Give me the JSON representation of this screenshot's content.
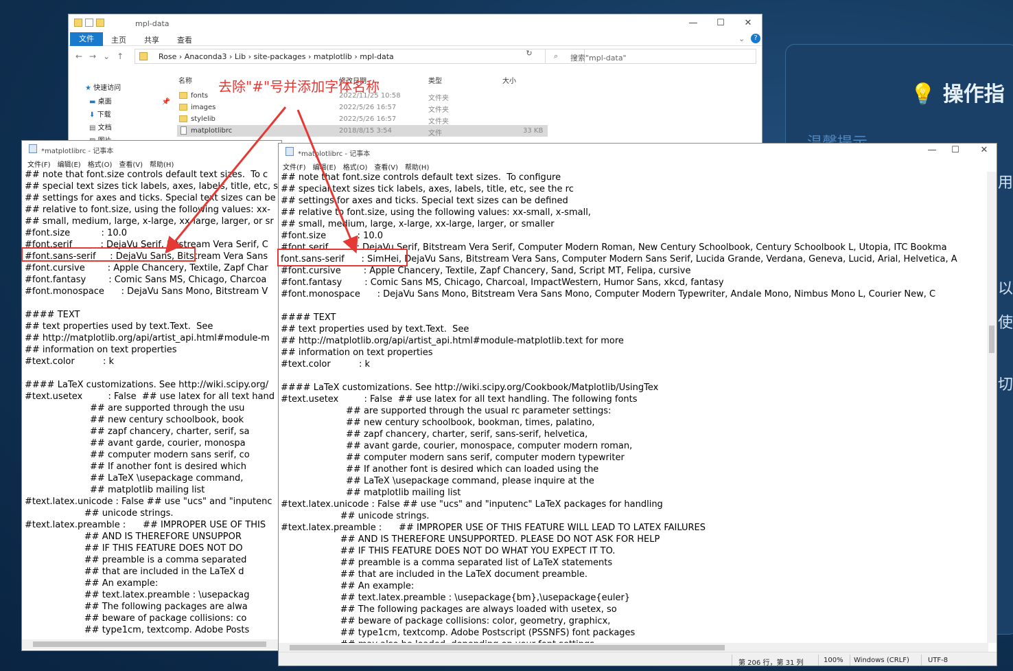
{
  "desktop": {
    "panel_title": "操作指",
    "panel_sub": "温馨提示",
    "side_chars": [
      "用",
      "以",
      "使",
      "切"
    ]
  },
  "explorer": {
    "title": "mpl-data",
    "ribbon": {
      "file": "文件",
      "home": "主页",
      "share": "共享",
      "view": "查看"
    },
    "breadcrumb": [
      "Rose",
      "Anaconda3",
      "Lib",
      "site-packages",
      "matplotlib",
      "mpl-data"
    ],
    "search_placeholder": "搜索\"mpl-data\"",
    "nav": [
      {
        "label": "快速访问",
        "icon": "star-icon"
      },
      {
        "label": "桌面",
        "icon": "desktop-icon"
      },
      {
        "label": "下载",
        "icon": "download-icon"
      },
      {
        "label": "文档",
        "icon": "document-icon"
      },
      {
        "label": "图片",
        "icon": "picture-icon"
      }
    ],
    "columns": {
      "name": "名称",
      "modified": "修改日期",
      "type": "类型",
      "size": "大小"
    },
    "files": [
      {
        "name": "fonts",
        "modified": "2022/11/25 10:58",
        "type": "文件夹",
        "size": "",
        "icon": "folder-icon"
      },
      {
        "name": "images",
        "modified": "2022/5/26 16:57",
        "type": "文件夹",
        "size": "",
        "icon": "folder-icon"
      },
      {
        "name": "stylelib",
        "modified": "2022/5/26 16:57",
        "type": "文件夹",
        "size": "",
        "icon": "folder-icon"
      },
      {
        "name": "matplotlibrc",
        "modified": "2018/8/15 3:54",
        "type": "文件",
        "size": "33 KB",
        "icon": "file-icon",
        "selected": true
      }
    ]
  },
  "annotation": "去除\"#\"号并添加字体名称",
  "notepad_left": {
    "title": "*matplotlibrc - 记事本",
    "menu": [
      "文件(F)",
      "编辑(E)",
      "格式(O)",
      "查看(V)",
      "帮助(H)"
    ],
    "lines": [
      "## note that font.size controls default text sizes.  To c",
      "## special text sizes tick labels, axes, labels, title, etc, s",
      "## settings for axes and ticks. Special text sizes can be",
      "## relative to font.size, using the following values: xx-",
      "## small, medium, large, x-large, xx-large, larger, or sr",
      "#font.size           : 10.0",
      "#font.serif          : DejaVu Serif, Bitstream Vera Serif, C",
      "#font.sans-serif     : DejaVu Sans, Bitstream Vera Sans",
      "#font.cursive        : Apple Chancery, Textile, Zapf Char",
      "#font.fantasy        : Comic Sans MS, Chicago, Charcoa",
      "#font.monospace      : DejaVu Sans Mono, Bitstream V",
      "",
      "#### TEXT",
      "## text properties used by text.Text.  See",
      "## http://matplotlib.org/api/artist_api.html#module-m",
      "## information on text properties",
      "#text.color          : k",
      "",
      "#### LaTeX customizations. See http://wiki.scipy.org/",
      "#text.usetex         : False  ## use latex for all text hand",
      "                       ## are supported through the usu",
      "                       ## new century schoolbook, book",
      "                       ## zapf chancery, charter, serif, sa",
      "                       ## avant garde, courier, monospa",
      "                       ## computer modern sans serif, co",
      "                       ## If another font is desired which",
      "                       ## LaTeX \\usepackage command,",
      "                       ## matplotlib mailing list",
      "#text.latex.unicode : False ## use \"ucs\" and \"inputenc",
      "                     ## unicode strings.",
      "#text.latex.preamble :      ## IMPROPER USE OF THIS",
      "                     ## AND IS THEREFORE UNSUPPOR",
      "                     ## IF THIS FEATURE DOES NOT DO",
      "                     ## preamble is a comma separated",
      "                     ## that are included in the LaTeX d",
      "                     ## An example:",
      "                     ## text.latex.preamble : \\usepackag",
      "                     ## The following packages are alwa",
      "                     ## beware of package collisions: co",
      "                     ## type1cm, textcomp. Adobe Posts"
    ]
  },
  "notepad_right": {
    "title": "*matplotlibrc - 记事本",
    "menu": [
      "文件(F)",
      "编辑(E)",
      "格式(O)",
      "查看(V)",
      "帮助(H)"
    ],
    "lines": [
      "## note that font.size controls default text sizes.  To configure",
      "## special text sizes tick labels, axes, labels, title, etc, see the rc",
      "## settings for axes and ticks. Special text sizes can be defined",
      "## relative to font.size, using the following values: xx-small, x-small,",
      "## small, medium, large, x-large, xx-large, larger, or smaller",
      "#font.size           : 10.0",
      "#font.serif          : DejaVu Serif, Bitstream Vera Serif, Computer Modern Roman, New Century Schoolbook, Century Schoolbook L, Utopia, ITC Bookma",
      "font.sans-serif      : SimHei, DejaVu Sans, Bitstream Vera Sans, Computer Modern Sans Serif, Lucida Grande, Verdana, Geneva, Lucid, Arial, Helvetica, A",
      "#font.cursive        : Apple Chancery, Textile, Zapf Chancery, Sand, Script MT, Felipa, cursive",
      "#font.fantasy        : Comic Sans MS, Chicago, Charcoal, ImpactWestern, Humor Sans, xkcd, fantasy",
      "#font.monospace      : DejaVu Sans Mono, Bitstream Vera Sans Mono, Computer Modern Typewriter, Andale Mono, Nimbus Mono L, Courier New, C",
      "",
      "#### TEXT",
      "## text properties used by text.Text.  See",
      "## http://matplotlib.org/api/artist_api.html#module-matplotlib.text for more",
      "## information on text properties",
      "#text.color          : k",
      "",
      "#### LaTeX customizations. See http://wiki.scipy.org/Cookbook/Matplotlib/UsingTex",
      "#text.usetex         : False  ## use latex for all text handling. The following fonts",
      "                       ## are supported through the usual rc parameter settings:",
      "                       ## new century schoolbook, bookman, times, palatino,",
      "                       ## zapf chancery, charter, serif, sans-serif, helvetica,",
      "                       ## avant garde, courier, monospace, computer modern roman,",
      "                       ## computer modern sans serif, computer modern typewriter",
      "                       ## If another font is desired which can loaded using the",
      "                       ## LaTeX \\usepackage command, please inquire at the",
      "                       ## matplotlib mailing list",
      "#text.latex.unicode : False ## use \"ucs\" and \"inputenc\" LaTeX packages for handling",
      "                     ## unicode strings.",
      "#text.latex.preamble :      ## IMPROPER USE OF THIS FEATURE WILL LEAD TO LATEX FAILURES",
      "                     ## AND IS THEREFORE UNSUPPORTED. PLEASE DO NOT ASK FOR HELP",
      "                     ## IF THIS FEATURE DOES NOT DO WHAT YOU EXPECT IT TO.",
      "                     ## preamble is a comma separated list of LaTeX statements",
      "                     ## that are included in the LaTeX document preamble.",
      "                     ## An example:",
      "                     ## text.latex.preamble : \\usepackage{bm},\\usepackage{euler}",
      "                     ## The following packages are always loaded with usetex, so",
      "                     ## beware of package collisions: color, geometry, graphicx,",
      "                     ## type1cm, textcomp. Adobe Postscript (PSSNFS) font packages",
      "                     ## may also be loaded, depending on your font settings."
    ],
    "status": {
      "position": "第 206 行，第 31 列",
      "zoom": "100%",
      "line_ending": "Windows (CRLF)",
      "encoding": "UTF-8"
    }
  },
  "colors": {
    "accent": "#1979ca",
    "annotation": "#e53935"
  }
}
